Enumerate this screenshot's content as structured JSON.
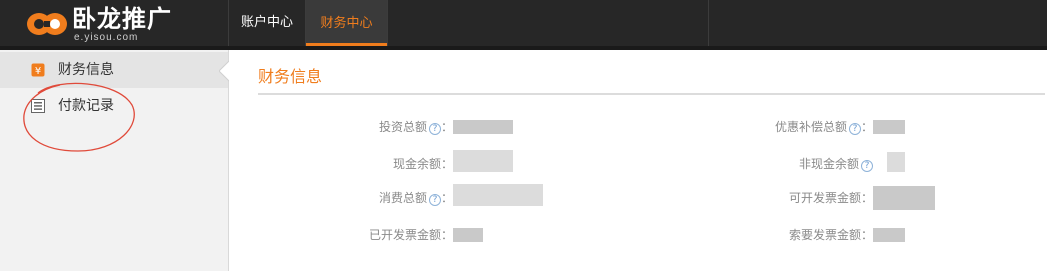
{
  "header": {
    "logo_text": "卧龙推广",
    "logo_sub": "e.yisou.com",
    "nav": [
      {
        "label": "账户中心",
        "active": false
      },
      {
        "label": "财务中心",
        "active": true
      }
    ]
  },
  "sidebar": {
    "items": [
      {
        "label": "财务信息",
        "icon": "finance-info-icon",
        "active": true
      },
      {
        "label": "付款记录",
        "icon": "payment-list-icon",
        "active": false
      }
    ]
  },
  "main": {
    "title": "财务信息",
    "left_fields": [
      {
        "label": "投资总额",
        "has_help": true,
        "suffix": "："
      },
      {
        "label": "现金余额",
        "has_help": false,
        "suffix": "："
      },
      {
        "label": "消费总额",
        "has_help": true,
        "suffix": "："
      },
      {
        "label": "已开发票金额",
        "has_help": false,
        "suffix": "："
      }
    ],
    "right_fields": [
      {
        "label": "优惠补偿总额",
        "has_help": true,
        "suffix": "："
      },
      {
        "label": "非现金余额",
        "has_help": true,
        "suffix": ""
      },
      {
        "label": "可开发票金额",
        "has_help": false,
        "suffix": "："
      },
      {
        "label": "索要发票金额",
        "has_help": false,
        "suffix": "："
      }
    ],
    "help_glyph": "?"
  },
  "colors": {
    "accent": "#f07d1d",
    "topbar": "#272727",
    "sidebar_bg": "#f2f2f2",
    "annotation": "#e04a3a"
  }
}
